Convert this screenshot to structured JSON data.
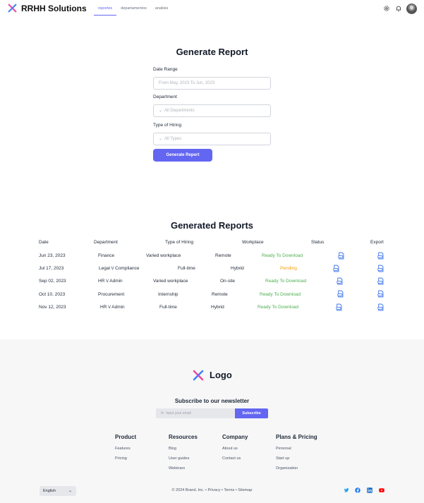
{
  "header": {
    "brand": "RRHH Solutions",
    "tabs": [
      {
        "label": "reportes"
      },
      {
        "label": "departamentos"
      },
      {
        "label": "analisis"
      }
    ]
  },
  "form": {
    "title": "Generate Report",
    "date_label": "Date Range",
    "date_placeholder": "From May, 2023 To Jun, 2023",
    "department_label": "Department",
    "department_placeholder": "All Departments",
    "hiring_label": "Type of Hiring",
    "hiring_placeholder": "All Types",
    "button": "Generate Report"
  },
  "reports": {
    "title": "Generated Reports",
    "columns": [
      "Date",
      "Department",
      "Type of Hiring",
      "Workplace",
      "Status",
      "Export"
    ],
    "rows": [
      {
        "date": "Jun 23, 2023",
        "department": "Finance",
        "hiring": "Varied workplace",
        "workplace": "Remote",
        "status": "Ready To Download"
      },
      {
        "date": "Jul 17, 2023",
        "department": "Legal \\/ Compliance",
        "hiring": "Full-time",
        "workplace": "Hybrid",
        "status": "Pending"
      },
      {
        "date": "Sep 02, 2023",
        "department": "HR \\/ Admin",
        "hiring": "Varied workplace",
        "workplace": "On-site",
        "status": "Ready To Download"
      },
      {
        "date": "Oct 10, 2023",
        "department": "Procurement",
        "hiring": "Internship",
        "workplace": "Remote",
        "status": "Ready To Download"
      },
      {
        "date": "Nov 12, 2023",
        "department": "HR \\/ Admin",
        "hiring": "Full-time",
        "workplace": "Hybrid",
        "status": "Ready To Download"
      }
    ]
  },
  "footer": {
    "logo": "Logo",
    "newsletter_title": "Subscribe to our newsletter",
    "newsletter_placeholder": "Input your email",
    "subscribe": "Subscribe",
    "columns": [
      {
        "title": "Product",
        "links": [
          "Features",
          "Pricing"
        ]
      },
      {
        "title": "Resources",
        "links": [
          "Blog",
          "User guides",
          "Webinars"
        ]
      },
      {
        "title": "Company",
        "links": [
          "About us",
          "Contact us"
        ]
      },
      {
        "title": "Plans & Pricing",
        "links": [
          "Personal",
          "Start up",
          "Organization"
        ]
      }
    ],
    "language": "English",
    "copyright": "© 2024 Brand, Inc. • Privacy • Terms • Sitemap",
    "social_icons": [
      "twitter-icon",
      "facebook-icon",
      "linkedin-icon",
      "youtube-icon"
    ]
  },
  "colors": {
    "accent": "#6366f1",
    "ready": "#4caf50",
    "pending": "#f59e0b"
  }
}
